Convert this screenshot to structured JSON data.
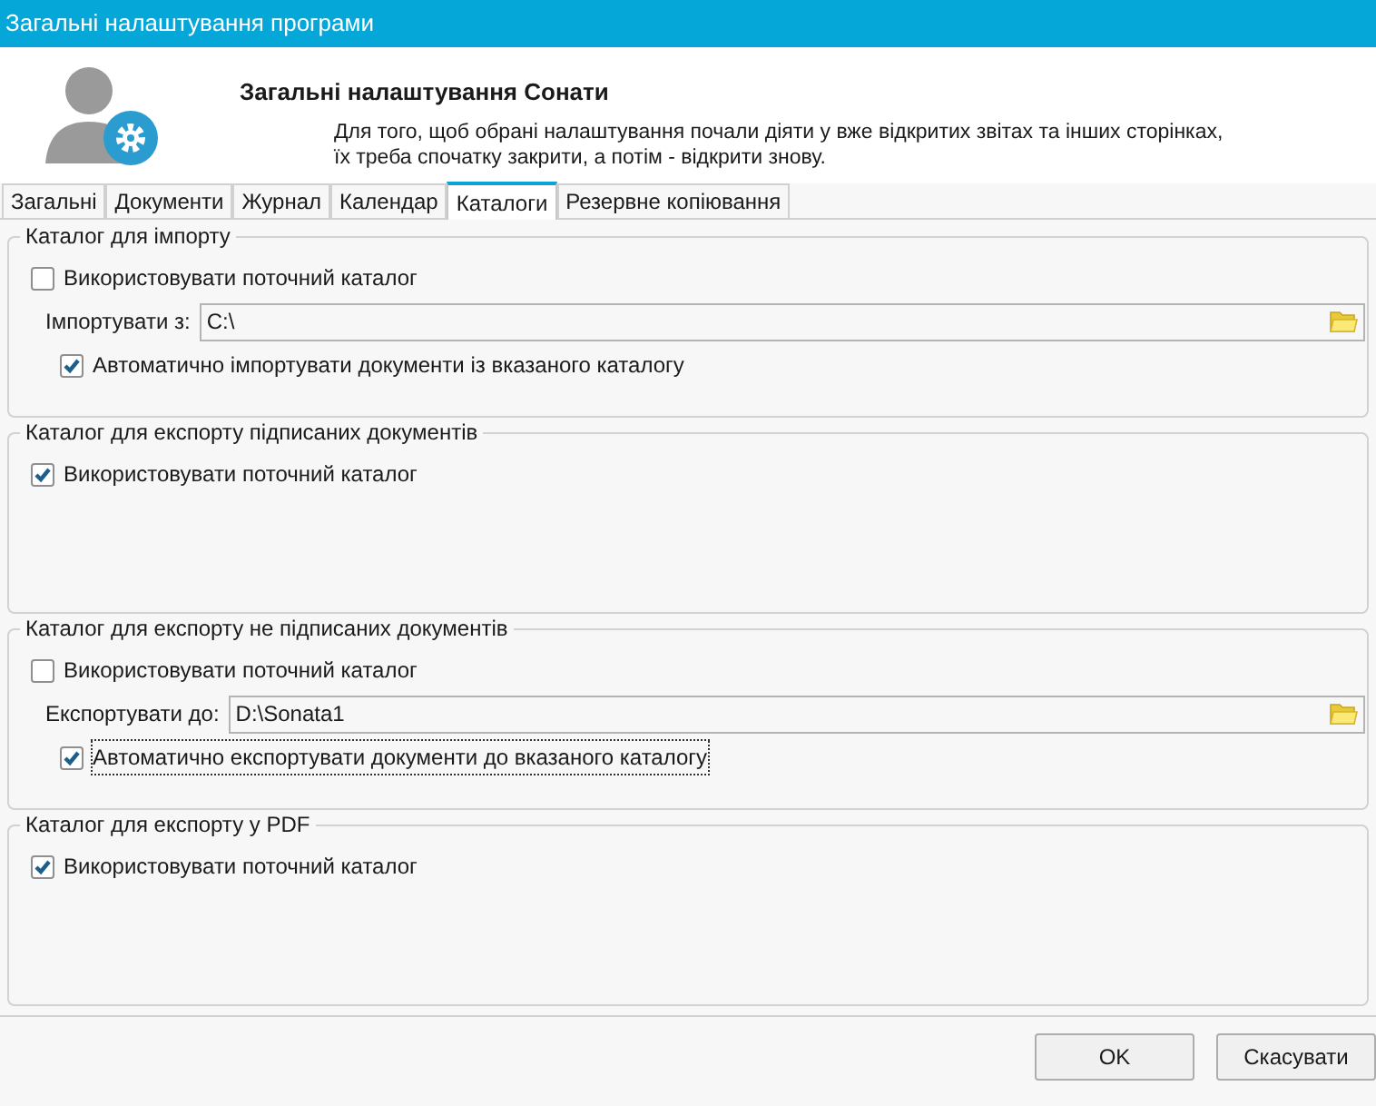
{
  "window": {
    "title": "Загальні налаштування програми"
  },
  "header": {
    "title": "Загальні налаштування Сонати",
    "description": "Для того, щоб обрані налаштування почали діяти у вже відкритих звітах та інших сторінках, їх треба спочатку закрити, а потім - відкрити знову."
  },
  "tabs": [
    {
      "label": "Загальні",
      "selected": false
    },
    {
      "label": "Документи",
      "selected": false
    },
    {
      "label": "Журнал",
      "selected": false
    },
    {
      "label": "Календар",
      "selected": false
    },
    {
      "label": "Каталоги",
      "selected": true
    },
    {
      "label": "Резервне копіювання",
      "selected": false
    }
  ],
  "groups": [
    {
      "title": "Каталог для імпорту",
      "items": [
        {
          "kind": "checkbox",
          "label": "Використовувати поточний каталог",
          "checked": false,
          "focused": false
        },
        {
          "kind": "path",
          "label": "Імпортувати з:",
          "value": "C:\\"
        },
        {
          "kind": "sub_checkbox",
          "label": "Автоматично імпортувати документи із вказаного каталогу",
          "checked": true,
          "focused": false
        }
      ]
    },
    {
      "title": "Каталог для експорту підписаних документів",
      "items": [
        {
          "kind": "checkbox",
          "label": "Використовувати поточний каталог",
          "checked": true,
          "focused": false
        }
      ]
    },
    {
      "title": "Каталог для експорту не підписаних документів",
      "items": [
        {
          "kind": "checkbox",
          "label": "Використовувати поточний каталог",
          "checked": false,
          "focused": false
        },
        {
          "kind": "path",
          "label": "Експортувати до:",
          "value": "D:\\Sonata1"
        },
        {
          "kind": "sub_checkbox",
          "label": "Автоматично експортувати документи до вказаного каталогу",
          "checked": true,
          "focused": true
        }
      ]
    },
    {
      "title": "Каталог для експорту у PDF",
      "items": [
        {
          "kind": "checkbox",
          "label": "Використовувати поточний каталог",
          "checked": true,
          "focused": false
        }
      ]
    }
  ],
  "buttons": [
    "OK",
    "Скасувати"
  ]
}
